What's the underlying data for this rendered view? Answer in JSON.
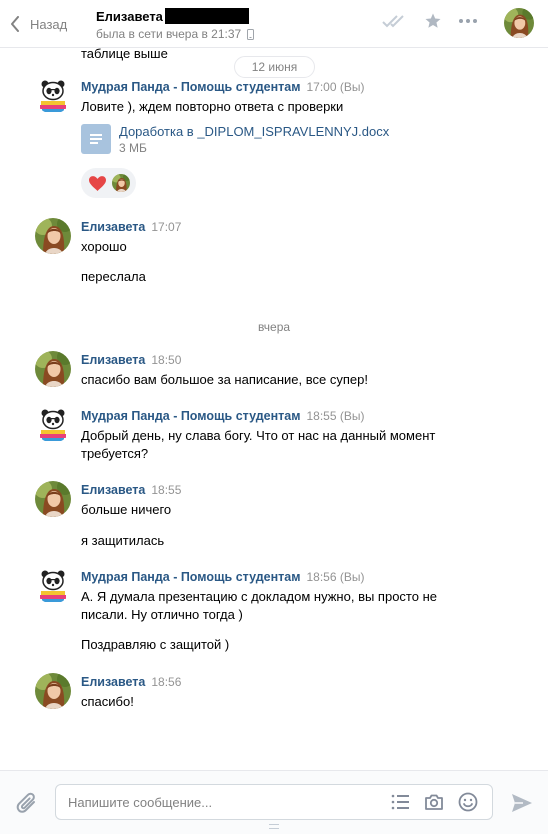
{
  "header": {
    "back_label": "Назад",
    "peer_name": "Елизавета",
    "peer_status": "была в сети вчера в 21:37"
  },
  "feed": {
    "cut_text": "таблице выше",
    "date_1": "12 июня",
    "date_2": "вчера",
    "messages": [
      {
        "author": "Мудрая Панда - Помощь студентам",
        "time": "17:00 (Вы)",
        "text": "Ловите ), ждем повторно ответа с проверки",
        "file_name": "Доработка в _DIPLOM_ISPRAVLENNYJ.docx",
        "file_size": "3 МБ"
      },
      {
        "author": "Елизавета",
        "time": "17:07",
        "text": "хорошо",
        "text_2": "переслала"
      },
      {
        "author": "Елизавета",
        "time": "18:50",
        "text": "спасибо вам большое за написание, все супер!"
      },
      {
        "author": "Мудрая Панда - Помощь студентам",
        "time": "18:55 (Вы)",
        "text": "Добрый день, ну слава богу. Что от нас на данный момент требуется?"
      },
      {
        "author": "Елизавета",
        "time": "18:55",
        "text": "больше ничего",
        "text_2": "я защитилась"
      },
      {
        "author": "Мудрая Панда - Помощь студентам",
        "time": "18:56 (Вы)",
        "text": "А. Я думала презентацию с докладом нужно, вы просто не писали. Ну отлично тогда )",
        "text_2": "Поздравляю с защитой )"
      },
      {
        "author": "Елизавета",
        "time": "18:56",
        "text": "спасибо!"
      }
    ]
  },
  "composer": {
    "placeholder": "Напишите сообщение..."
  },
  "colors": {
    "link": "#2a5885",
    "muted": "#828282",
    "file_icon": "#a8c3de",
    "heart": "#e64646"
  },
  "icons": [
    "chevron-left-icon",
    "phone-icon",
    "double-check-icon",
    "star-icon",
    "more-icon",
    "document-icon",
    "heart-icon",
    "paperclip-icon",
    "list-icon",
    "camera-icon",
    "smile-icon",
    "send-icon"
  ]
}
